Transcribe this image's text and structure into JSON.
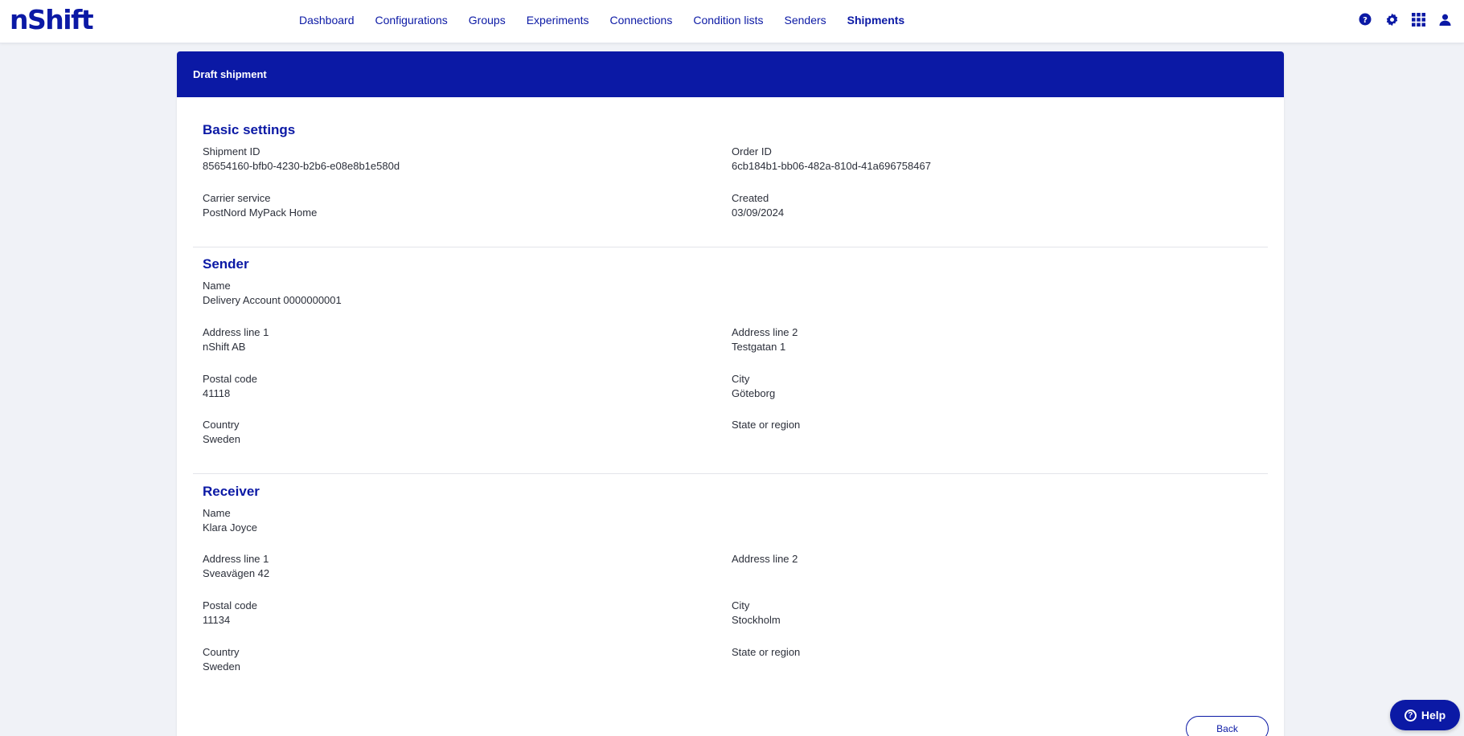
{
  "brand": {
    "logo": "nShift"
  },
  "nav": {
    "items": [
      {
        "label": "Dashboard"
      },
      {
        "label": "Configurations"
      },
      {
        "label": "Groups"
      },
      {
        "label": "Experiments"
      },
      {
        "label": "Connections"
      },
      {
        "label": "Condition lists"
      },
      {
        "label": "Senders"
      },
      {
        "label": "Shipments"
      }
    ],
    "active": "Shipments"
  },
  "top_icons": [
    "help-icon",
    "gear-icon",
    "apps-grid-icon",
    "user-icon"
  ],
  "colors": {
    "primary": "#0b19a5",
    "background": "#f0f2f7",
    "card": "#ffffff"
  },
  "card": {
    "title": "Draft shipment"
  },
  "basic": {
    "heading": "Basic settings",
    "shipment_id_label": "Shipment ID",
    "shipment_id": "85654160-bfb0-4230-b2b6-e08e8b1e580d",
    "order_id_label": "Order ID",
    "order_id": "6cb184b1-bb06-482a-810d-41a696758467",
    "carrier_label": "Carrier service",
    "carrier": "PostNord MyPack Home",
    "created_label": "Created",
    "created": "03/09/2024"
  },
  "sender": {
    "heading": "Sender",
    "name_label": "Name",
    "name": "Delivery Account 0000000001",
    "addr1_label": "Address line 1",
    "addr1": "nShift AB",
    "addr2_label": "Address line 2",
    "addr2": "Testgatan 1",
    "postal_label": "Postal code",
    "postal": "41118",
    "city_label": "City",
    "city": "Göteborg",
    "country_label": "Country",
    "country": "Sweden",
    "state_label": "State or region",
    "state": ""
  },
  "receiver": {
    "heading": "Receiver",
    "name_label": "Name",
    "name": "Klara Joyce",
    "addr1_label": "Address line 1",
    "addr1": "Sveavägen 42",
    "addr2_label": "Address line 2",
    "addr2": "",
    "postal_label": "Postal code",
    "postal": "11134",
    "city_label": "City",
    "city": "Stockholm",
    "country_label": "Country",
    "country": "Sweden",
    "state_label": "State or region",
    "state": ""
  },
  "actions": {
    "back": "Back",
    "help": "Help"
  }
}
